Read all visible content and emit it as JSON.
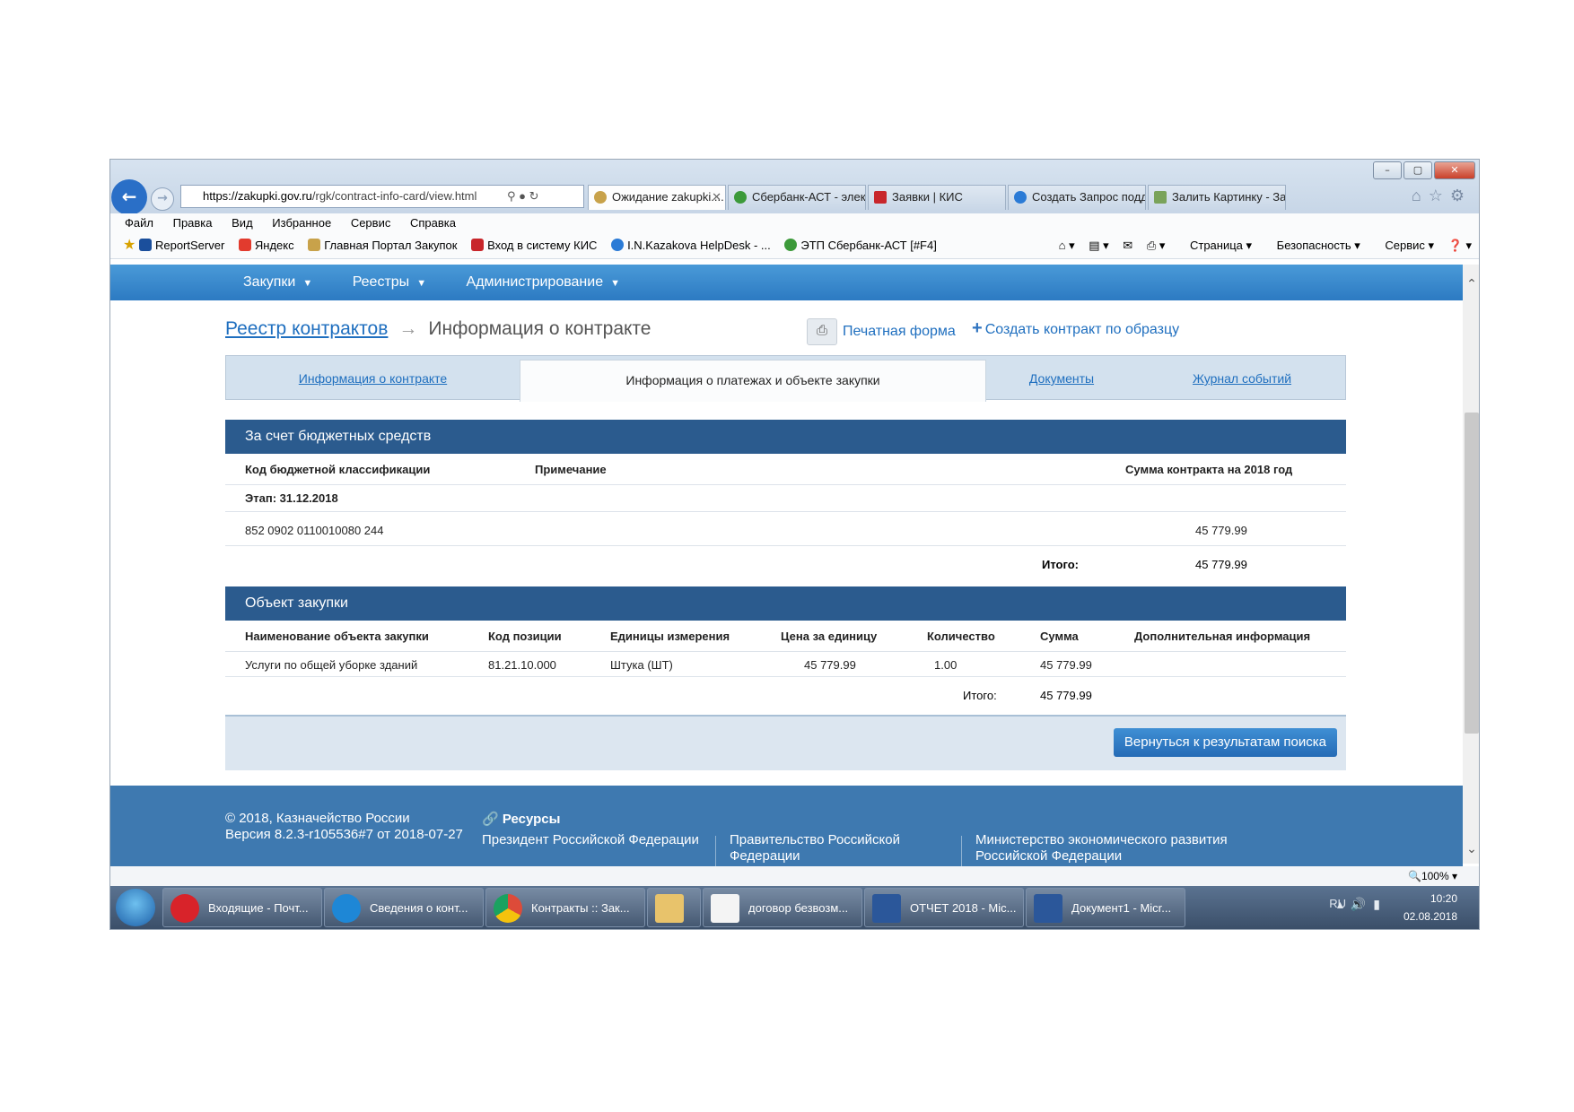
{
  "browser": {
    "url_domain": "https://zakupki.gov.ru",
    "url_path": "/rgk/contract-info-card/view.html",
    "tabs": [
      {
        "title": "Ожидание zakupki...."
      },
      {
        "title": "Сбербанк-АСТ - элек..."
      },
      {
        "title": "Заявки | КИС"
      },
      {
        "title": "Создать Запрос подд..."
      },
      {
        "title": "Залить Картинку - За..."
      }
    ],
    "menu": [
      "Файл",
      "Правка",
      "Вид",
      "Избранное",
      "Сервис",
      "Справка"
    ],
    "favorites": [
      "ReportServer",
      "Яндекс",
      "Главная Портал Закупок",
      "Вход в систему КИС",
      "I.N.Kazakova HelpDesk - ...",
      "ЭТП Сбербанк-АСТ [#F4]"
    ],
    "commands": [
      "Страница",
      "Безопасность",
      "Сервис"
    ],
    "zoom": "100%",
    "window_buttons": {
      "minimize": "–",
      "maximize": "▢",
      "close": "✕"
    }
  },
  "site_nav": [
    "Закупки",
    "Реестры",
    "Администрирование"
  ],
  "breadcrumb": {
    "root": "Реестр контрактов",
    "current": "Информация о контракте"
  },
  "actions": {
    "print": "Печатная форма",
    "create": "Создать контракт по образцу"
  },
  "page_tabs": [
    {
      "label": "Информация о контракте",
      "active": false
    },
    {
      "label": "Информация о платежах и объекте закупки",
      "active": true
    },
    {
      "label": "Документы",
      "active": false
    },
    {
      "label": "Журнал событий",
      "active": false
    }
  ],
  "budget": {
    "title": "За счет бюджетных средств",
    "headers": [
      "Код бюджетной классификации",
      "Примечание",
      "Сумма контракта на 2018 год"
    ],
    "stage": "Этап: 31.12.2018",
    "row": {
      "code": "852 0902 0110010080 244",
      "amount": "45 779.99"
    },
    "total_label": "Итого:",
    "total": "45 779.99"
  },
  "object": {
    "title": "Объект закупки",
    "headers": [
      "Наименование объекта закупки",
      "Код позиции",
      "Единицы измерения",
      "Цена за единицу",
      "Количество",
      "Сумма",
      "Дополнительная информация"
    ],
    "row": {
      "name": "Услуги по общей уборке зданий",
      "code": "81.21.10.000",
      "unit": "Штука (ШТ)",
      "price": "45 779.99",
      "qty": "1.00",
      "sum": "45 779.99"
    },
    "total_label": "Итого:",
    "total": "45 779.99"
  },
  "back_button": "Вернуться к результатам поиска",
  "footer": {
    "copyright": "© 2018, Казначейство России",
    "version": "Версия 8.2.3-r105536#7 от 2018-07-27",
    "resources_title": "Ресурсы",
    "links": [
      "Президент Российской Федерации",
      "Правительство Российской Федерации",
      "Министерство экономического развития Российской Федерации"
    ]
  },
  "taskbar": {
    "items": [
      "Входящие - Почт...",
      "Сведения о конт...",
      "Контракты :: Зак...",
      "",
      "договор безвозм...",
      "ОТЧЕТ 2018 - Mic...",
      "Документ1 - Micr..."
    ],
    "lang": "RU",
    "time": "10:20",
    "date": "02.08.2018"
  }
}
